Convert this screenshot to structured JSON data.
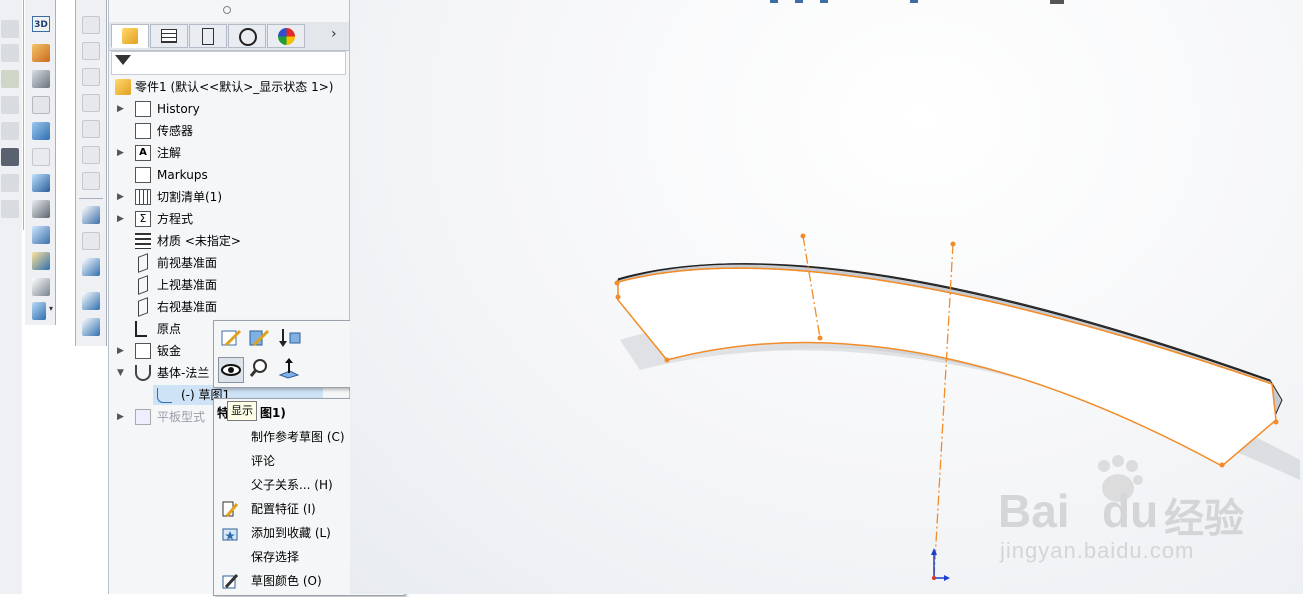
{
  "tree": {
    "root": "零件1 (默认<<默认>_显示状态 1>)",
    "items": [
      {
        "label": "History"
      },
      {
        "label": "传感器"
      },
      {
        "label": "注解"
      },
      {
        "label": "Markups"
      },
      {
        "label": "切割清单(1)"
      },
      {
        "label": "方程式"
      },
      {
        "label": "材质 <未指定>"
      },
      {
        "label": "前视基准面"
      },
      {
        "label": "上视基准面"
      },
      {
        "label": "右视基准面"
      },
      {
        "label": "原点"
      },
      {
        "label": "钣金"
      },
      {
        "label": "基体-法兰"
      },
      {
        "label": "(-) 草图1"
      },
      {
        "label": "平板型式"
      }
    ]
  },
  "context_menu": {
    "header": "特",
    "header_suffix": "图1)",
    "items": [
      {
        "label": "制作参考草图 (C)"
      },
      {
        "label": "评论"
      },
      {
        "label": "父子关系... (H)"
      },
      {
        "label": "配置特征 (I)"
      },
      {
        "label": "添加到收藏 (L)"
      },
      {
        "label": "保存选择"
      },
      {
        "label": "草图颜色 (O)"
      }
    ]
  },
  "tooltip": "显示",
  "watermark": {
    "brand": "Bai",
    "brand2": "du",
    "cn": "经验",
    "url": "jingyan.baidu.com"
  },
  "toolbar_3d_label": "3D",
  "colors": {
    "sketch_orange": "#f28c28",
    "selection_blue": "#cfe3f7"
  }
}
